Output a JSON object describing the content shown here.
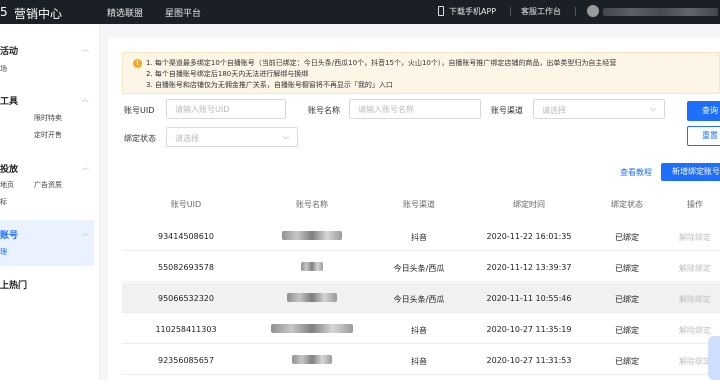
{
  "topbar": {
    "logo_fragment": "5",
    "title": "营销中心",
    "nav": [
      "精选联盟",
      "星图平台"
    ],
    "download_app": "下载手机APP",
    "service": "客服工作台"
  },
  "sidebar": {
    "groups": [
      {
        "label": "活动",
        "subs": [
          "场"
        ]
      },
      {
        "label": "工具",
        "subs": [
          "限时特卖",
          "定时开售"
        ]
      },
      {
        "label": "投放",
        "subs": [
          "地页",
          "广告资质",
          "标"
        ]
      },
      {
        "label": "账号",
        "subs": [
          "理"
        ]
      },
      {
        "label": "上热门",
        "subs": []
      }
    ]
  },
  "notice": {
    "lines": [
      "1. 每个渠道最多绑定10个自播账号（当前已绑定：今日头条/西瓜10个，抖音15个，火山10个），自播账号推广绑定店铺的商品，出单类型归为自主经营",
      "2. 每个自播账号绑定后180天内无法进行解绑与换绑",
      "3. 自播账号和店铺仅为无佣金推广关系，自播账号橱窗将不再显示「我的」入口"
    ]
  },
  "filters": {
    "uid_label": "账号UID",
    "uid_placeholder": "请输入账号UID",
    "name_label": "账号名称",
    "name_placeholder": "请输入账号名称",
    "channel_label": "账号渠道",
    "channel_placeholder": "请选择",
    "status_label": "绑定状态",
    "status_placeholder": "请选择",
    "search": "查询",
    "reset": "重置"
  },
  "actions": {
    "tutorial": "查看教程",
    "add": "新增绑定账号"
  },
  "table": {
    "headers": [
      "账号UID",
      "账号名称",
      "账号渠道",
      "绑定时间",
      "绑定状态",
      "操作"
    ],
    "rows": [
      {
        "uid": "93414508610",
        "name": "",
        "channel": "抖音",
        "time": "2020-11-22 16:01:35",
        "status": "已绑定",
        "action": "解除绑定"
      },
      {
        "uid": "55082693578",
        "name": "",
        "channel": "今日头条/西瓜",
        "time": "2020-11-12 13:39:37",
        "status": "已绑定",
        "action": "解除绑定"
      },
      {
        "uid": "95066532320",
        "name": "",
        "channel": "今日头条/西瓜",
        "time": "2020-11-11 10:55:46",
        "status": "已绑定",
        "action": "解除绑定"
      },
      {
        "uid": "110258411303",
        "name": "",
        "channel": "抖音",
        "time": "2020-10-27 11:35:19",
        "status": "已绑定",
        "action": "解除绑定"
      },
      {
        "uid": "92356085657",
        "name": "",
        "channel": "抖音",
        "time": "2020-10-27 11:31:53",
        "status": "已绑定",
        "action": "解除绑定"
      }
    ]
  }
}
